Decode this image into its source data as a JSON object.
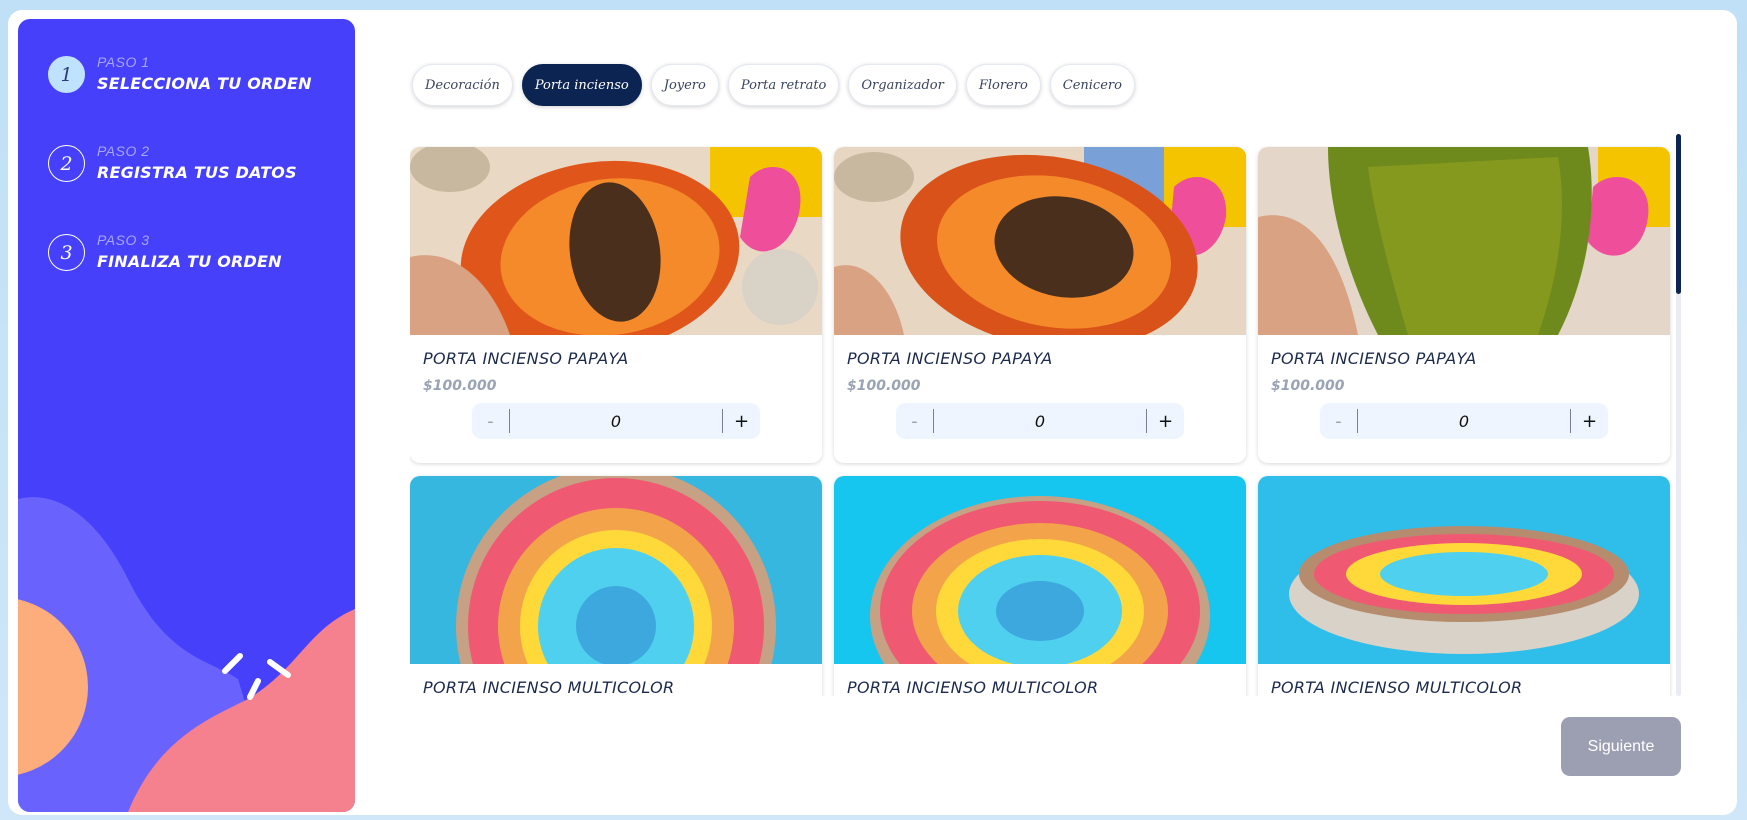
{
  "steps": [
    {
      "number": "1",
      "kicker": "PASO 1",
      "title": "SELECCIONA TU ORDEN",
      "active": true
    },
    {
      "number": "2",
      "kicker": "PASO 2",
      "title": "REGISTRA TUS DATOS",
      "active": false
    },
    {
      "number": "3",
      "kicker": "PASO 3",
      "title": "FINALIZA TU ORDEN",
      "active": false
    }
  ],
  "tabs": [
    {
      "label": "Decoración",
      "active": false
    },
    {
      "label": "Porta incienso",
      "active": true
    },
    {
      "label": "Joyero",
      "active": false
    },
    {
      "label": "Porta retrato",
      "active": false
    },
    {
      "label": "Organizador",
      "active": false
    },
    {
      "label": "Florero",
      "active": false
    },
    {
      "label": "Cenicero",
      "active": false
    }
  ],
  "products": [
    {
      "name": "PORTA INCIENSO PAPAYA",
      "price": "$100.000",
      "quantity": "0",
      "image": "papaya-plate-photo"
    },
    {
      "name": "PORTA INCIENSO PAPAYA",
      "price": "$100.000",
      "quantity": "0",
      "image": "papaya-plate-photo"
    },
    {
      "name": "PORTA INCIENSO PAPAYA",
      "price": "$100.000",
      "quantity": "0",
      "image": "green-papaya-plate-amarilla-photo"
    },
    {
      "name": "PORTA INCIENSO MULTICOLOR",
      "price": "",
      "quantity": "",
      "image": "multicolor-plate-photo"
    },
    {
      "name": "PORTA INCIENSO MULTICOLOR",
      "price": "",
      "quantity": "",
      "image": "multicolor-plate-photo"
    },
    {
      "name": "PORTA INCIENSO MULTICOLOR",
      "price": "",
      "quantity": "",
      "image": "multicolor-plate-side-photo"
    }
  ],
  "stepper": {
    "minus": "-",
    "plus": "+"
  },
  "next_button": "Siguiente",
  "colors": {
    "sidebar": "#4640fb",
    "active_tab": "#0b2452",
    "orange_circle": "#fdac7b",
    "pink_wave": "#f5808e",
    "next_button": "#9c9fb2"
  }
}
